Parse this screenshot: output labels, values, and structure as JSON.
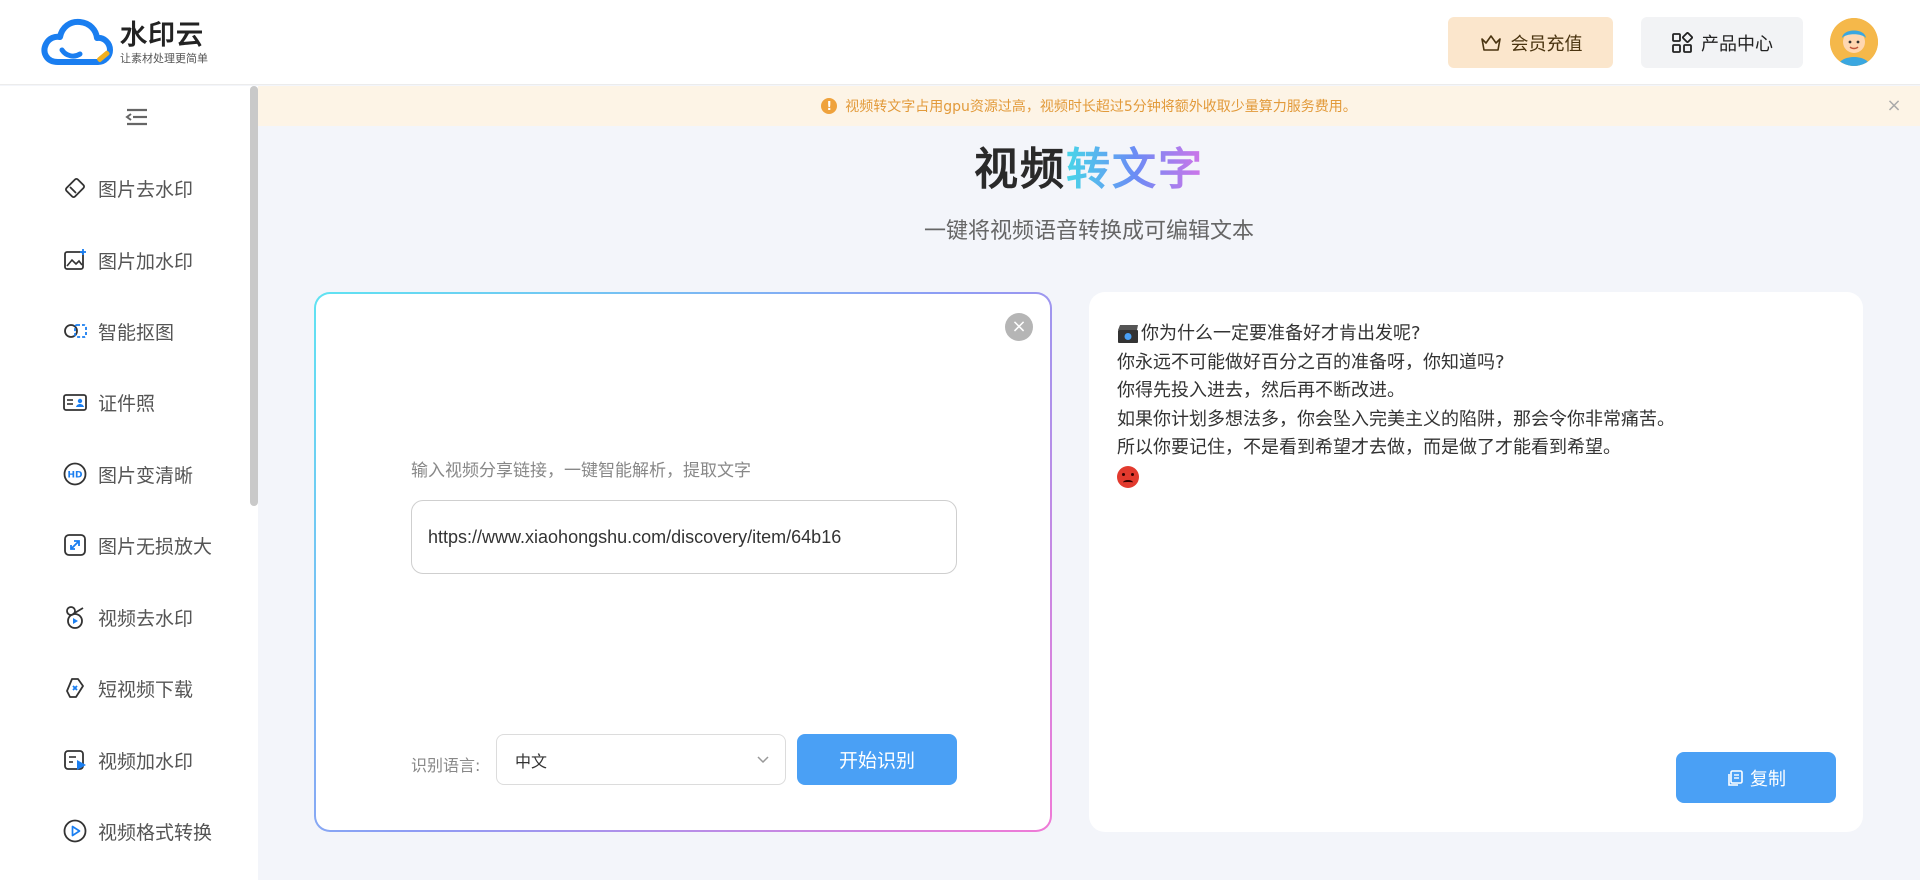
{
  "brand": {
    "name": "水印云",
    "slogan": "让素材处理更简单"
  },
  "header": {
    "vip_label": "会员充值",
    "products_label": "产品中心"
  },
  "sidebar": {
    "items": [
      {
        "label": "图片去水印",
        "icon": "eraser-icon"
      },
      {
        "label": "图片加水印",
        "icon": "image-add-icon"
      },
      {
        "label": "智能抠图",
        "icon": "cutout-icon"
      },
      {
        "label": "证件照",
        "icon": "id-card-icon"
      },
      {
        "label": "图片变清晰",
        "icon": "hd-icon"
      },
      {
        "label": "图片无损放大",
        "icon": "enlarge-icon"
      },
      {
        "label": "视频去水印",
        "icon": "video-eraser-icon"
      },
      {
        "label": "短视频下载",
        "icon": "link-icon"
      },
      {
        "label": "视频加水印",
        "icon": "video-add-icon"
      },
      {
        "label": "视频格式转换",
        "icon": "play-circle-icon"
      }
    ]
  },
  "notice": {
    "text": "视频转文字占用gpu资源过高，视频时长超过5分钟将额外收取少量算力服务费用。",
    "close": "×"
  },
  "page": {
    "title_dark": "视频",
    "title_color": "转文字",
    "subtitle": "一键将视频语音转换成可编辑文本"
  },
  "input_panel": {
    "close": "×",
    "hint": "输入视频分享链接，一键智能解析，提取文字",
    "url_value": "https://www.xiaohongshu.com/discovery/item/64b16",
    "lang_label": "识别语言:",
    "lang_value": "中文",
    "start_label": "开始识别"
  },
  "result_panel": {
    "lines": [
      "你为什么一定要准备好才肯出发呢?",
      "你永远不可能做好百分之百的准备呀，你知道吗?",
      "你得先投入进去，然后再不断改进。",
      "如果你计划多想法多，你会坠入完美主义的陷阱，那会令你非常痛苦。",
      "所以你要记住，不是看到希望才去做，而是做了才能看到希望。"
    ],
    "copy_label": "复制"
  },
  "colors": {
    "accent": "#4aa0f5",
    "notice": "#e29a3a",
    "vip_bg": "#fbe6cc"
  }
}
